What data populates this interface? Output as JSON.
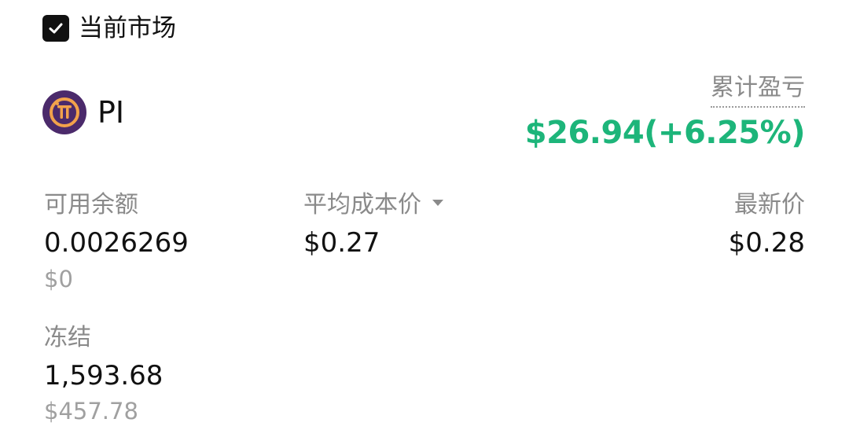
{
  "filter": {
    "current_market_label": "当前市场",
    "checked": true
  },
  "asset": {
    "symbol": "PI",
    "logo_icon": "pi-network-logo-icon"
  },
  "pnl": {
    "label": "累计盈亏",
    "value": "$26.94(+6.25%)",
    "color": "#1db57a"
  },
  "available": {
    "label": "可用余额",
    "amount": "0.0026269",
    "usd": "$0"
  },
  "avg_cost": {
    "label": "平均成本价",
    "value": "$0.27"
  },
  "latest": {
    "label": "最新价",
    "value": "$0.28"
  },
  "frozen": {
    "label": "冻结",
    "amount": "1,593.68",
    "usd": "$457.78"
  }
}
